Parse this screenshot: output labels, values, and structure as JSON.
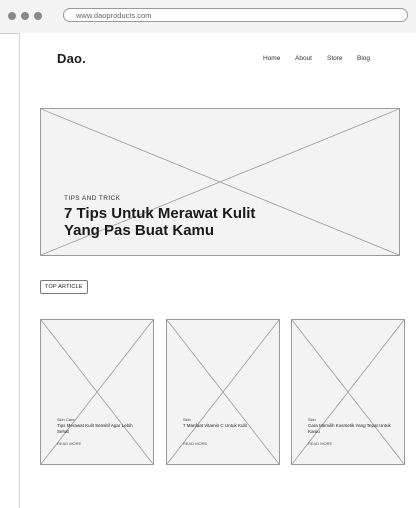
{
  "browser": {
    "url": "www.daoproducts.com"
  },
  "site": {
    "logo": "Dao.",
    "nav": [
      "Home",
      "About",
      "Store",
      "Blog"
    ]
  },
  "hero": {
    "kicker": "TIPS AND TRICK",
    "title": "7 Tips Untuk Merawat Kulit Yang Pas Buat Kamu"
  },
  "section": {
    "tag": "TOP ARTICLE"
  },
  "cards": [
    {
      "category": "Skin Care",
      "title": "Tips Merawat Kulit Sensitif Agar Lebih Sehat",
      "more": "READ MORE"
    },
    {
      "category": "Skin",
      "title": "7 Manfaat Vitamin C Untuk Kulit",
      "more": "READ MORE"
    },
    {
      "category": "Skin",
      "title": "Cara Memilih Kosmetik Yang Tepat Untuk Kamu",
      "more": "READ MORE"
    }
  ],
  "colors": {
    "placeholder_fill": "#f3f3f3",
    "placeholder_stroke": "#9a9a9a"
  }
}
